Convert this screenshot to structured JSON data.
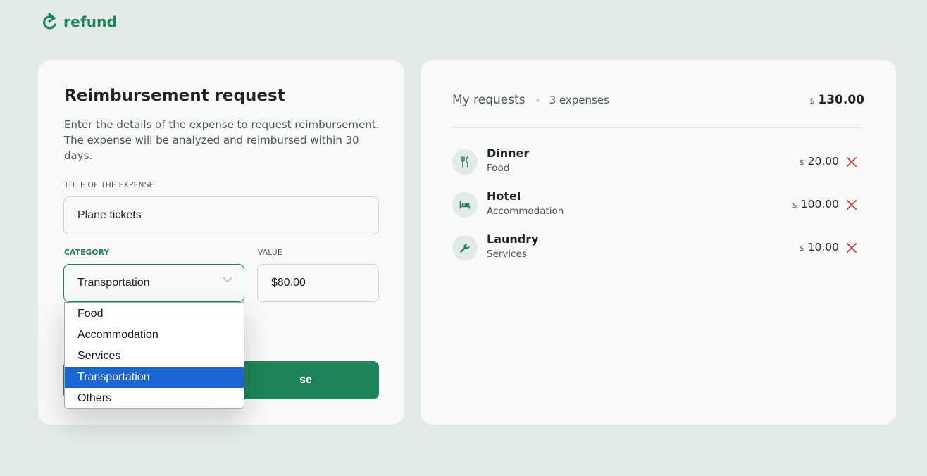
{
  "brand": {
    "name": "refund",
    "icon": "redo-arrow-icon",
    "color": "#1f8459"
  },
  "form": {
    "title": "Reimbursement request",
    "description": "Enter the details of the expense to request reimbursement. The expense will be analyzed and reimbursed within 30 days.",
    "title_field": {
      "label": "TITLE OF THE EXPENSE",
      "value": "Plane tickets"
    },
    "category_field": {
      "label": "CATEGORY",
      "value": "Transportation",
      "options": [
        "Food",
        "Accommodation",
        "Services",
        "Transportation",
        "Others"
      ],
      "selected_option": "Transportation"
    },
    "value_field": {
      "label": "VALUE",
      "value": "$80.00"
    },
    "submit_label_visible": "se"
  },
  "requests": {
    "title": "My requests",
    "count_label": "3 expenses",
    "currency": "$",
    "total": "130.00",
    "items": [
      {
        "name": "Dinner",
        "category": "Food",
        "currency": "$",
        "amount": "20.00",
        "icon": "utensils-icon"
      },
      {
        "name": "Hotel",
        "category": "Accommodation",
        "currency": "$",
        "amount": "100.00",
        "icon": "bed-icon"
      },
      {
        "name": "Laundry",
        "category": "Services",
        "currency": "$",
        "amount": "10.00",
        "icon": "wrench-icon"
      }
    ]
  },
  "colors": {
    "background": "#e3ebe8",
    "card": "#f8faf9",
    "accent": "#1f8459",
    "remove": "#c93b3b",
    "dropdown_selected": "#1a66d2"
  }
}
